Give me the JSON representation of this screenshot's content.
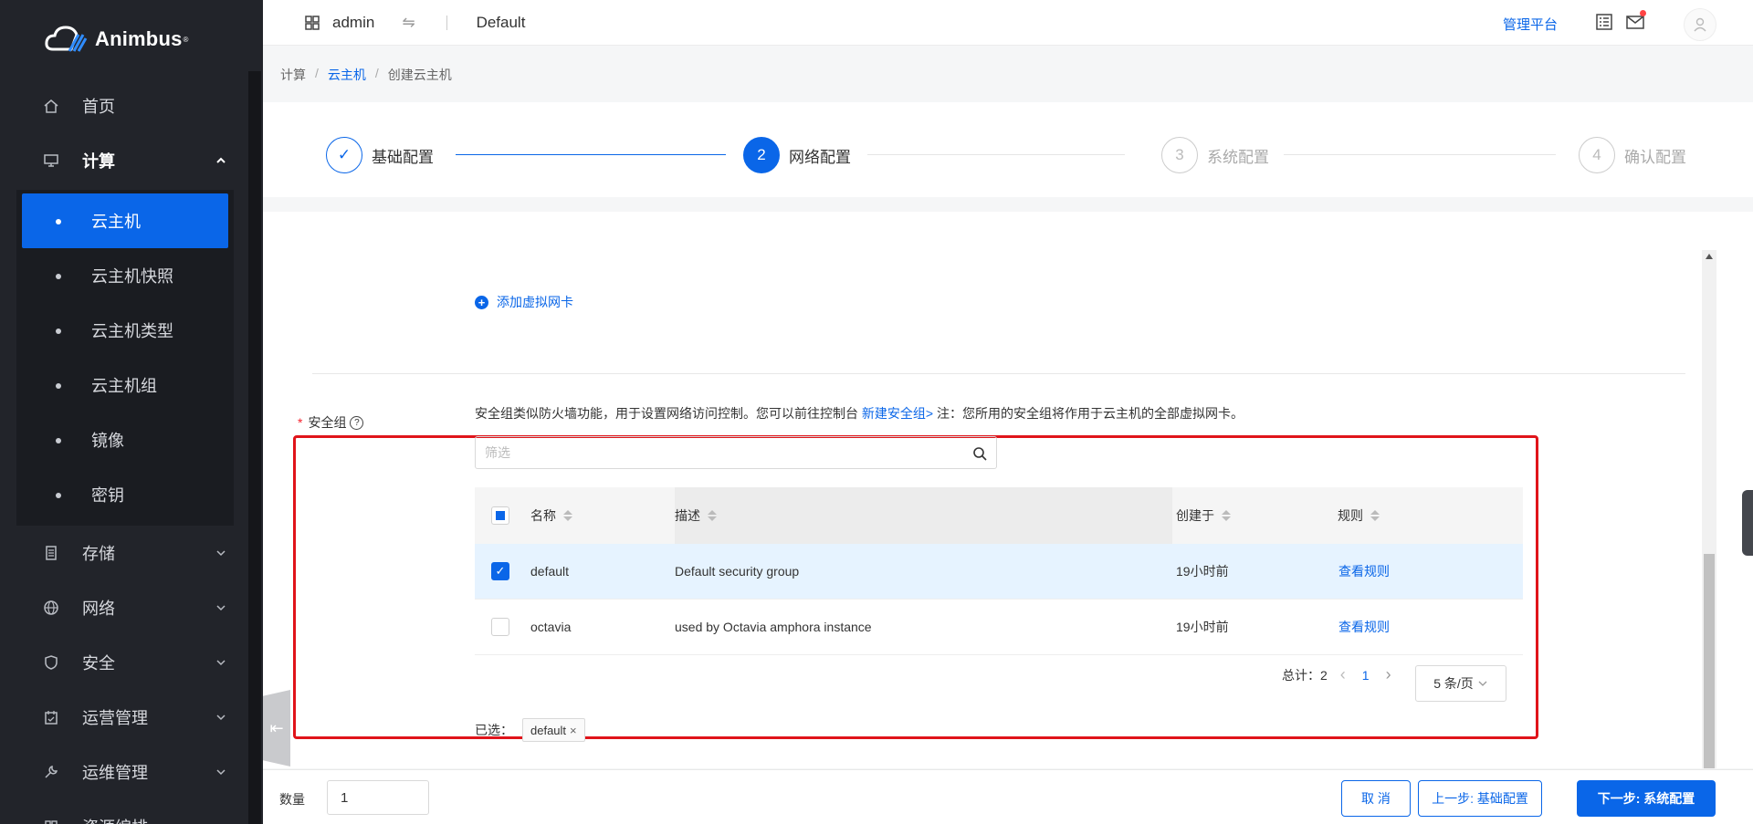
{
  "app": {
    "name": "Animbus",
    "trademark": "®"
  },
  "sidebar": {
    "items": [
      {
        "label": "首页",
        "icon": "home-icon"
      },
      {
        "label": "计算",
        "icon": "monitor-icon",
        "open": true,
        "children": [
          {
            "label": "云主机",
            "active": true
          },
          {
            "label": "云主机快照"
          },
          {
            "label": "云主机类型"
          },
          {
            "label": "云主机组"
          },
          {
            "label": "镜像"
          },
          {
            "label": "密钥"
          }
        ]
      },
      {
        "label": "存储",
        "icon": "storage-icon"
      },
      {
        "label": "网络",
        "icon": "globe-icon"
      },
      {
        "label": "安全",
        "icon": "shield-icon"
      },
      {
        "label": "运营管理",
        "icon": "calendar-icon"
      },
      {
        "label": "运维管理",
        "icon": "wrench-icon"
      },
      {
        "label": "资源编排",
        "icon": "grid-icon"
      }
    ]
  },
  "topbar": {
    "user": "admin",
    "project": "Default",
    "admin_link": "管理平台"
  },
  "breadcrumb": [
    "计算",
    "云主机",
    "创建云主机"
  ],
  "steps": [
    {
      "num": "1",
      "label": "基础配置",
      "state": "done"
    },
    {
      "num": "2",
      "label": "网络配置",
      "state": "current"
    },
    {
      "num": "3",
      "label": "系统配置",
      "state": "todo"
    },
    {
      "num": "4",
      "label": "确认配置",
      "state": "todo"
    }
  ],
  "network": {
    "add_nic": "添加虚拟网卡"
  },
  "security_group": {
    "label": "安全组",
    "desc_prefix": "安全组类似防火墙功能，用于设置网络访问控制。您可以前往控制台 ",
    "desc_link": "新建安全组>",
    "desc_suffix": " 注：您所用的安全组将作用于云主机的全部虚拟网卡。",
    "filter_placeholder": "筛选",
    "columns": [
      "名称",
      "描述",
      "创建于",
      "规则"
    ],
    "rows": [
      {
        "name": "default",
        "description": "Default security group",
        "created": "19小时前",
        "rules": "查看规则",
        "checked": true
      },
      {
        "name": "octavia",
        "description": "used by Octavia amphora instance",
        "created": "19小时前",
        "rules": "查看规则",
        "checked": false
      }
    ],
    "total_label": "总计：",
    "total": "2",
    "page": "1",
    "page_size": "5 条/页",
    "selected_label": "已选：",
    "selected_tag": "default"
  },
  "footer": {
    "qty_label": "数量",
    "qty_value": "1",
    "cancel": "取 消",
    "prev": "上一步: 基础配置",
    "next": "下一步: 系统配置"
  }
}
